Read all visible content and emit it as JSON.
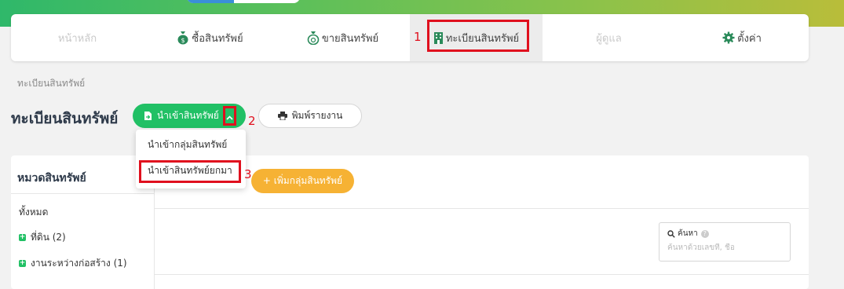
{
  "nav": {
    "items": [
      {
        "label": "หน้าหลัก",
        "icon": "home",
        "disabled": true
      },
      {
        "label": "ซื้อสินทรัพย์",
        "icon": "money-bag-icon"
      },
      {
        "label": "ขายสินทรัพย์",
        "icon": "money-bag-sell-icon"
      },
      {
        "label": "ทะเบียนสินทรัพย์",
        "icon": "building-icon",
        "active": true
      },
      {
        "label": "ผู้ดูแล",
        "icon": "user",
        "disabled": true
      },
      {
        "label": "ตั้งค่า",
        "icon": "gear-icon"
      }
    ]
  },
  "annotations": {
    "n1": "1",
    "n2": "2",
    "n3": "3",
    "color": "#e0101e"
  },
  "breadcrumb": "ทะเบียนสินทรัพย์",
  "page_title": "ทะเบียนสินทรัพย์",
  "toolbar": {
    "import_label": "นำเข้าสินทรัพย์",
    "print_label": "พิมพ์รายงาน"
  },
  "dropdown": {
    "items": [
      "นำเข้ากลุ่มสินทรัพย์",
      "นำเข้าสินทรัพย์ยกมา"
    ]
  },
  "sidebar": {
    "header": "หมวดสินทรัพย์",
    "all_label": "ทั้งหมด",
    "items": [
      "ที่ดิน (2)",
      "งานระหว่างก่อสร้าง (1)"
    ]
  },
  "add_group_label": "+ เพิ่มกลุ่มสินทรัพย์",
  "search": {
    "label": "ค้นหา",
    "placeholder": "ค้นหาด้วยเลขที่, ชื่อ"
  },
  "colors": {
    "primary": "#21c065",
    "accent": "#f6b234"
  }
}
